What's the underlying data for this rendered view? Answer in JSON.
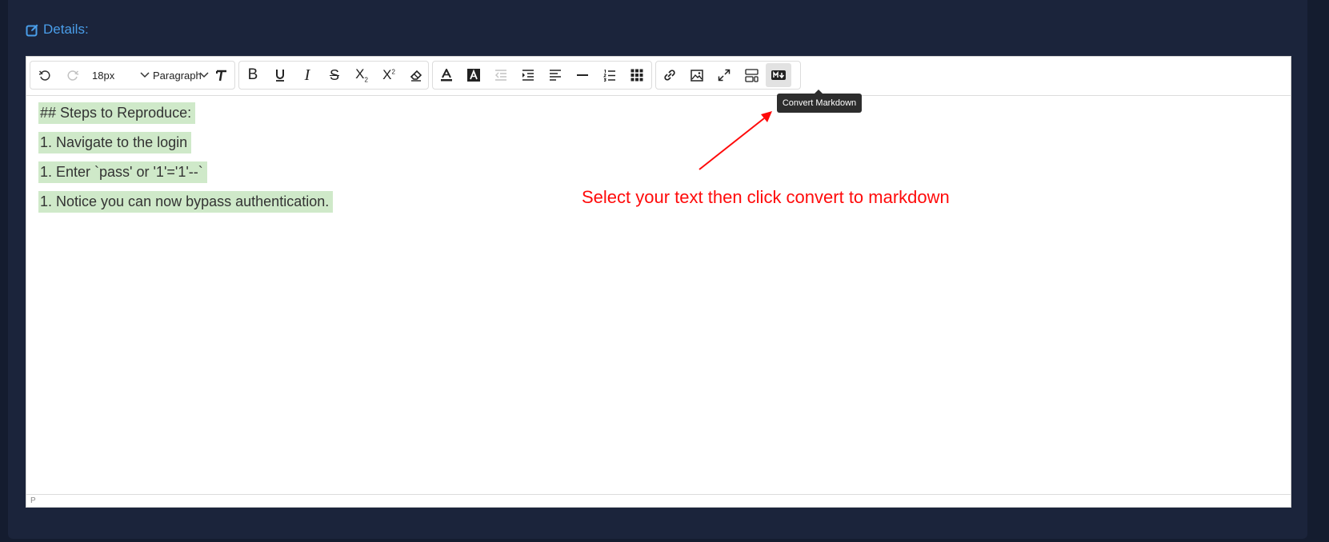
{
  "details_label": "Details:",
  "toolbar": {
    "undo_title": "Undo",
    "redo_title": "Redo",
    "font_size": "18px",
    "block_format": "Paragraph",
    "bold_glyph": "B",
    "italic_glyph": "I",
    "strike_glyph": "S",
    "subscript_glyph": "X",
    "subscript_mark": "2",
    "superscript_glyph": "X",
    "superscript_mark": "2"
  },
  "content": {
    "lines": [
      "## Steps to Reproduce:",
      "1. Navigate to the login",
      "1. Enter `pass' or '1'='1'--`",
      "1. Notice you can now bypass authentication."
    ]
  },
  "statusbar": {
    "path": "P"
  },
  "tooltip": {
    "text": "Convert Markdown"
  },
  "annotation": {
    "text": "Select your text then click convert to markdown",
    "color": "#ff0a0a"
  },
  "colors": {
    "background": "#141c2f",
    "panel": "#1b243b",
    "label_accent": "#4a9eea",
    "text_highlight": "#cfe9c9"
  }
}
